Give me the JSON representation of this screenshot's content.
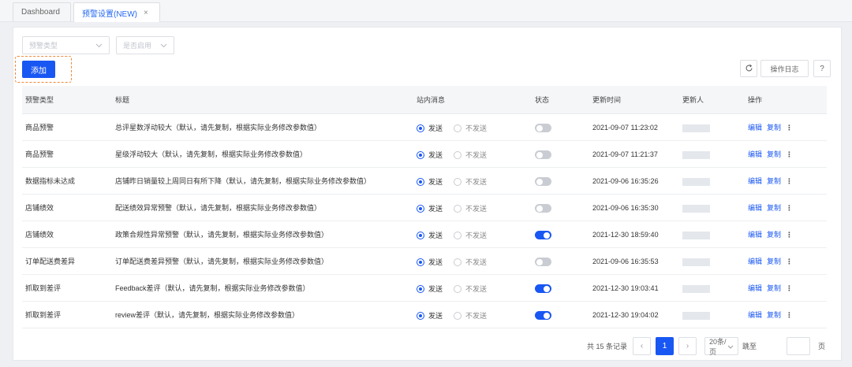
{
  "tabs": [
    {
      "label": "Dashboard"
    },
    {
      "label": "预警设置(NEW)",
      "close": "×"
    }
  ],
  "filters": {
    "type_placeholder": "预警类型",
    "enabled_placeholder": "是否启用"
  },
  "toolbar": {
    "add_label": "添加",
    "log_label": "操作日志",
    "help_label": "?"
  },
  "table": {
    "headers": [
      "预警类型",
      "标题",
      "站内消息",
      "状态",
      "更新时间",
      "更新人",
      "操作"
    ],
    "radio_send": "发送",
    "radio_nosend": "不发送",
    "edit_label": "编辑",
    "copy_label": "复制",
    "rows": [
      {
        "type": "商品预警",
        "title": "总评星数浮动较大（默认，请先复制，根据实际业务修改参数值）",
        "status_on": false,
        "time": "2021-09-07 11:23:02"
      },
      {
        "type": "商品预警",
        "title": "星级浮动较大（默认，请先复制，根据实际业务修改参数值）",
        "status_on": false,
        "time": "2021-09-07 11:21:37"
      },
      {
        "type": "数据指标未达成",
        "title": "店铺昨日销量较上周同日有所下降（默认，请先复制，根据实际业务修改参数值）",
        "status_on": false,
        "time": "2021-09-06 16:35:26"
      },
      {
        "type": "店铺绩效",
        "title": "配送绩效异常预警（默认，请先复制，根据实际业务修改参数值）",
        "status_on": false,
        "time": "2021-09-06 16:35:30"
      },
      {
        "type": "店铺绩效",
        "title": "政策合规性异常预警（默认，请先复制，根据实际业务修改参数值）",
        "status_on": true,
        "time": "2021-12-30 18:59:40"
      },
      {
        "type": "订单配送费差异",
        "title": "订单配送费差异预警（默认，请先复制，根据实际业务修改参数值）",
        "status_on": false,
        "time": "2021-09-06 16:35:53"
      },
      {
        "type": "抓取到差评",
        "title": "Feedback差评（默认，请先复制，根据实际业务修改参数值）",
        "status_on": true,
        "time": "2021-12-30 19:03:41"
      },
      {
        "type": "抓取到差评",
        "title": "review差评（默认，请先复制，根据实际业务修改参数值）",
        "status_on": true,
        "time": "2021-12-30 19:04:02"
      }
    ]
  },
  "pagination": {
    "total": "共 15 条记录",
    "current": "1",
    "prev": "‹",
    "next": "›",
    "page_size": "20条/页",
    "goto_label": "跳至",
    "page_unit": "页"
  },
  "colors": {
    "accent": "#1957f3",
    "highlight_border": "#f08a3a"
  }
}
